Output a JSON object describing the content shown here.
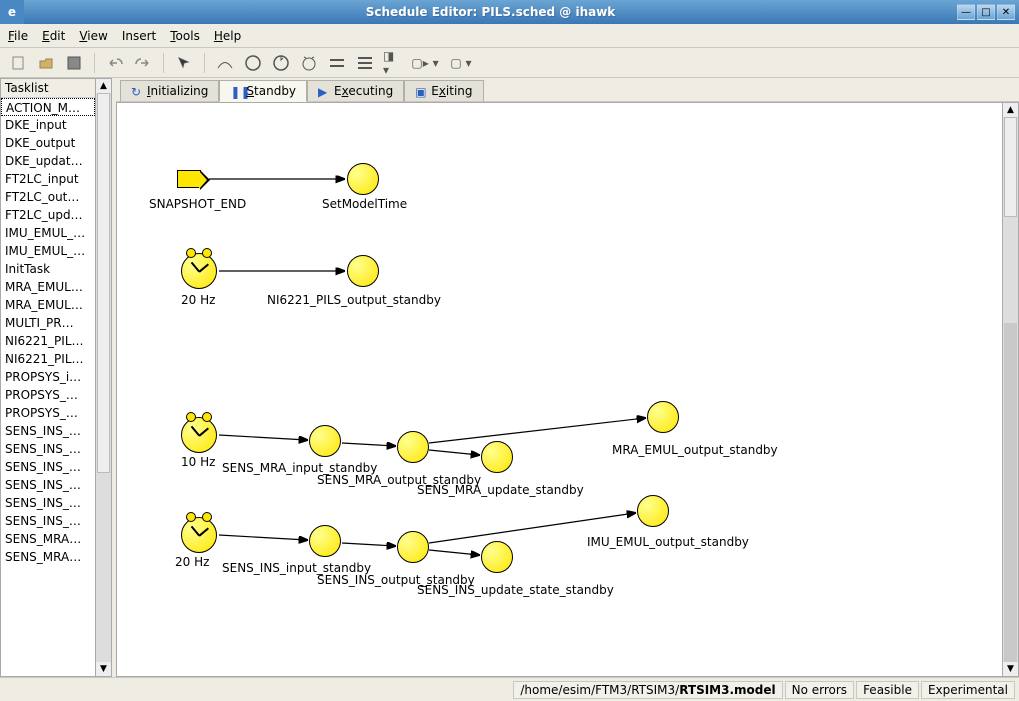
{
  "window": {
    "appIcon": "e",
    "title": "Schedule Editor: PILS.sched @ ihawk"
  },
  "menu": {
    "file": "File",
    "edit": "Edit",
    "view": "View",
    "insert": "Insert",
    "tools": "Tools",
    "help": "Help"
  },
  "tabs": {
    "initializing": "Initializing",
    "standby": "Standby",
    "executing": "Executing",
    "exiting": "Exiting"
  },
  "tasklist": {
    "header": "Tasklist",
    "items": [
      "ACTION_M…",
      "DKE_input",
      "DKE_output",
      "DKE_updat…",
      "FT2LC_input",
      "FT2LC_out…",
      "FT2LC_upd…",
      "IMU_EMUL_…",
      "IMU_EMUL_…",
      "InitTask",
      "MRA_EMUL…",
      "MRA_EMUL…",
      "MULTI_PR…",
      "NI6221_PIL…",
      "NI6221_PIL…",
      "PROPSYS_i…",
      "PROPSYS_…",
      "PROPSYS_…",
      "SENS_INS_…",
      "SENS_INS_…",
      "SENS_INS_…",
      "SENS_INS_…",
      "SENS_INS_…",
      "SENS_INS_…",
      "SENS_MRA…",
      "SENS_MRA…"
    ]
  },
  "diagram": {
    "row1": {
      "start": "SNAPSHOT_END",
      "task": "SetModelTime"
    },
    "row2": {
      "clock": "20 Hz",
      "task": "NI6221_PILS_output_standby"
    },
    "row3": {
      "clock": "10 Hz",
      "t1": "SENS_MRA_input_standby",
      "t2": "SENS_MRA_output_standby",
      "t3": "SENS_MRA_update_standby",
      "t4": "MRA_EMUL_output_standby"
    },
    "row4": {
      "clock": "20 Hz",
      "t1": "SENS_INS_input_standby",
      "t2": "SENS_INS_output_standby",
      "t3": "SENS_INS_update_state_standby",
      "t4": "IMU_EMUL_output_standby"
    }
  },
  "status": {
    "path_prefix": "/home/esim/FTM3/RTSIM3/",
    "path_bold": "RTSIM3.model",
    "errors": "No errors",
    "feasible": "Feasible",
    "experimental": "Experimental"
  }
}
